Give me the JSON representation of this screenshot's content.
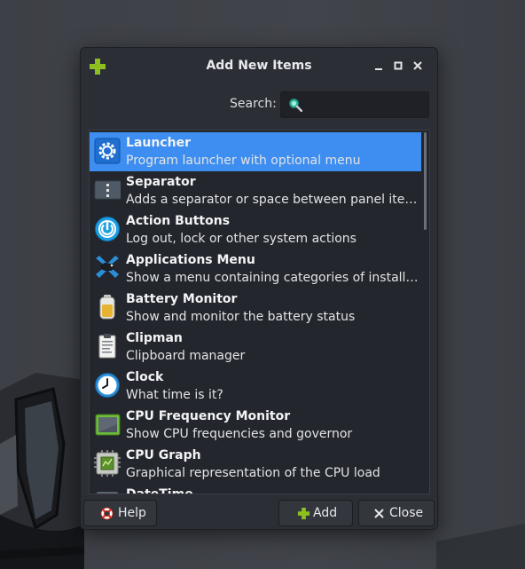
{
  "dialog": {
    "title": "Add New Items",
    "search_label": "Search:",
    "search_value": "",
    "search_placeholder": ""
  },
  "items": [
    {
      "name": "Launcher",
      "desc": "Program launcher with optional menu",
      "icon": "launcher-gear-icon"
    },
    {
      "name": "Separator",
      "desc": "Adds a separator or space between panel items",
      "icon": "separator-icon"
    },
    {
      "name": "Action Buttons",
      "desc": "Log out, lock or other system actions",
      "icon": "power-icon"
    },
    {
      "name": "Applications Menu",
      "desc": "Show a menu containing categories of installed ap…",
      "icon": "applications-menu-icon"
    },
    {
      "name": "Battery Monitor",
      "desc": "Show and monitor the battery status",
      "icon": "battery-icon"
    },
    {
      "name": "Clipman",
      "desc": "Clipboard manager",
      "icon": "clipboard-icon"
    },
    {
      "name": "Clock",
      "desc": "What time is it?",
      "icon": "clock-icon"
    },
    {
      "name": "CPU Frequency Monitor",
      "desc": "Show CPU frequencies and governor",
      "icon": "cpu-frequency-icon"
    },
    {
      "name": "CPU Graph",
      "desc": "Graphical representation of the CPU load",
      "icon": "cpu-graph-icon"
    },
    {
      "name": "DateTime",
      "desc": "",
      "icon": "datetime-icon"
    }
  ],
  "buttons": {
    "help": "Help",
    "add": "Add",
    "close": "Close"
  },
  "colors": {
    "selection": "#3d8ef0",
    "accent_green": "#8dc01f"
  }
}
